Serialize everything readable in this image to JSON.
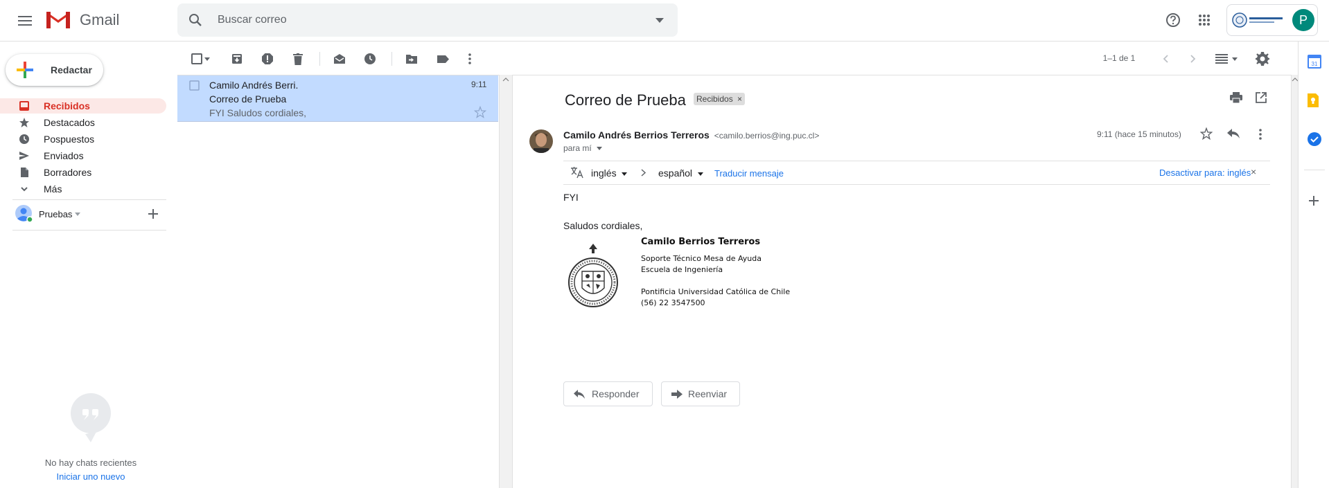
{
  "app": {
    "name": "Gmail"
  },
  "search": {
    "placeholder": "Buscar correo"
  },
  "header": {
    "avatar_letter": "P"
  },
  "compose": {
    "label": "Redactar"
  },
  "nav": {
    "items": [
      {
        "label": "Recibidos",
        "icon": "inbox-icon",
        "active": true
      },
      {
        "label": "Destacados",
        "icon": "star-icon"
      },
      {
        "label": "Pospuestos",
        "icon": "clock-icon"
      },
      {
        "label": "Enviados",
        "icon": "send-icon"
      },
      {
        "label": "Borradores",
        "icon": "draft-icon"
      },
      {
        "label": "Más",
        "icon": "chevron-down-icon"
      }
    ]
  },
  "hangouts": {
    "user": "Pruebas",
    "empty_text": "No hay chats recientes",
    "start_link": "Iniciar uno nuevo"
  },
  "toolbar": {
    "pagination": "1–1 de 1"
  },
  "list": {
    "rows": [
      {
        "sender": "Camilo Andrés Berri.",
        "subject": "Correo de Prueba",
        "snippet": "FYI Saludos cordiales,",
        "time": "9:11"
      }
    ]
  },
  "message": {
    "subject": "Correo de Prueba",
    "label_chip": "Recibidos",
    "sender_name": "Camilo Andrés Berrios Terreros",
    "sender_email": "<camilo.berrios@ing.puc.cl>",
    "to": "para mí",
    "time": "9:11 (hace 15 minutos)",
    "body_line1": "FYI",
    "body_line2": "Saludos cordiales,",
    "signature": {
      "name": "Camilo Berrios Terreros",
      "line1": "Soporte Técnico Mesa de Ayuda",
      "line2": "Escuela de Ingeniería",
      "line3": "Pontificia Universidad Católica de Chile",
      "line4": "(56) 22 3547500",
      "seal_text": "PONTIFICIA UNIVERSIDAD CATOLICA DE CHILE"
    }
  },
  "translate": {
    "from": "inglés",
    "to": "español",
    "action": "Traducir mensaje",
    "disable": "Desactivar para: inglés"
  },
  "actions": {
    "reply": "Responder",
    "forward": "Reenviar"
  },
  "colors": {
    "accent_red": "#d93025",
    "selected_row": "#c2dbff",
    "link_blue": "#1a73e8",
    "avatar_green": "#00897b"
  }
}
